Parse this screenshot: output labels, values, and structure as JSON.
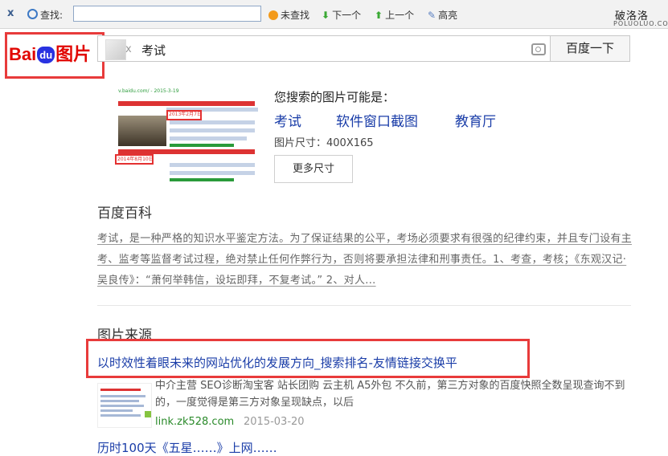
{
  "find_bar": {
    "close": "x",
    "label": "查找:",
    "search_value": "",
    "not_found": "未查找",
    "next": "下一个",
    "prev": "上一个",
    "highlight": "高亮"
  },
  "watermark": {
    "title": "破洛洛",
    "url": "POLUOLUO.COM"
  },
  "logo": {
    "bai": "Bai",
    "du": "du",
    "pic": "图片"
  },
  "search": {
    "query": "考试",
    "button": "百度一下",
    "clear": "x"
  },
  "guess": {
    "title": "您搜索的图片可能是：",
    "links": [
      "考试",
      "软件窗口截图",
      "教育厅"
    ],
    "size_label": "图片尺寸：400X165",
    "more_sizes": "更多尺寸"
  },
  "thumb": {
    "line1": "v.baidu.com/ - 2015-3-19",
    "date1": "2013年2月7日",
    "date2": "2014年8月10日"
  },
  "baike": {
    "title": "百度百科",
    "text": "考试，是一种严格的知识水平鉴定方法。为了保证结果的公平，考场必须要求有很强的纪律约束，并且专门设有主考、监考等监督考试过程，绝对禁止任何作弊行为，否则将要承担法律和刑事责任。1、考查，考核；《东观汉记·吴良传》：“萧何举韩信，设坛即拜，不复考试。” 2、对人..."
  },
  "source": {
    "title": "图片来源",
    "link": "以时效性着眼未来的网站优化的发展方向_搜索排名-友情链接交换平",
    "desc": "中介主营 SEO诊断淘宝客 站长团购 云主机 A5外包 不久前，第三方对象的百度快照全数呈现查询不到的，一度觉得是第三方对象呈现缺点，以后",
    "domain": "link.zk528.com",
    "date": "2015-03-20",
    "next_title": "历时100天《五星……》上网……"
  }
}
